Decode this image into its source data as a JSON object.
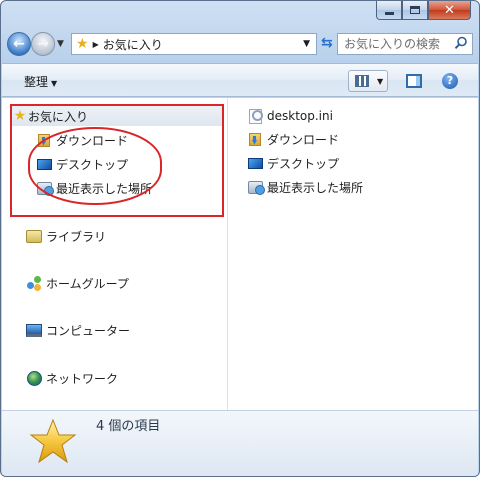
{
  "window": {
    "caption": {
      "min": "minimize",
      "max": "maximize",
      "close": "x"
    }
  },
  "address": {
    "path": "お気に入り",
    "search_placeholder": "お気に入りの検索"
  },
  "toolbar": {
    "organize_label": "整理",
    "help_label": "?"
  },
  "nav_pane": {
    "favorites": {
      "header": "お気に入り",
      "items": [
        {
          "label": "ダウンロード",
          "icon": "download-folder-icon"
        },
        {
          "label": "デスクトップ",
          "icon": "desktop-icon"
        },
        {
          "label": "最近表示した場所",
          "icon": "recent-places-icon"
        }
      ]
    },
    "libraries": "ライブラリ",
    "homegroup": "ホームグループ",
    "computer": "コンピューター",
    "network": "ネットワーク"
  },
  "file_pane": {
    "items": [
      {
        "label": "desktop.ini",
        "icon": "ini-file-icon"
      },
      {
        "label": "ダウンロード",
        "icon": "download-folder-icon"
      },
      {
        "label": "デスクトップ",
        "icon": "desktop-icon"
      },
      {
        "label": "最近表示した場所",
        "icon": "recent-places-icon"
      }
    ]
  },
  "details": {
    "count_text": "4 個の項目"
  },
  "colors": {
    "annotation_red": "#d9262a",
    "star": "#eab320",
    "accent_blue": "#2a6fc9"
  }
}
